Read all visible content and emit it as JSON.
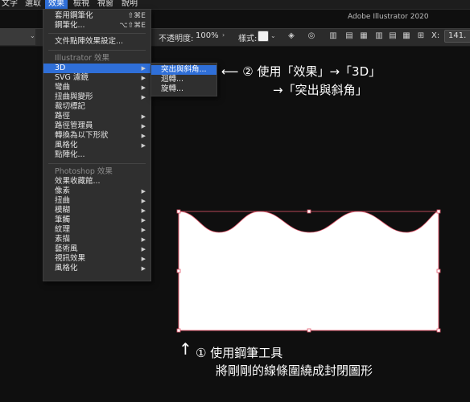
{
  "menubar": {
    "items": [
      {
        "label": "文字",
        "active": false
      },
      {
        "label": "選取",
        "active": false
      },
      {
        "label": "效果",
        "active": true
      },
      {
        "label": "檢視",
        "active": false
      },
      {
        "label": "視窗",
        "active": false
      },
      {
        "label": "說明",
        "active": false
      }
    ]
  },
  "app_title": "Adobe Illustrator 2020",
  "controlbar": {
    "opacity_label": "不透明度:",
    "opacity_value": "100%",
    "style_label": "樣式:",
    "x_label": "X:",
    "x_value": "141."
  },
  "effect_menu": {
    "apply_last": {
      "label": "套用鋼筆化",
      "shortcut": "⇧⌘E"
    },
    "last_effect": {
      "label": "鋼筆化...",
      "shortcut": "⌥⇧⌘E"
    },
    "document_raster": "文件點陣效果設定...",
    "illustrator_section": "Illustrator 效果",
    "illustrator_items": [
      {
        "label": "3D",
        "submenu": true,
        "highlighted": true
      },
      {
        "label": "SVG 濾鏡",
        "submenu": true
      },
      {
        "label": "彎曲",
        "submenu": true
      },
      {
        "label": "扭曲與變形",
        "submenu": true
      },
      {
        "label": "裁切標記",
        "submenu": false
      },
      {
        "label": "路徑",
        "submenu": true
      },
      {
        "label": "路徑管理員",
        "submenu": true
      },
      {
        "label": "轉換為以下形狀",
        "submenu": true
      },
      {
        "label": "風格化",
        "submenu": true
      },
      {
        "label": "點陣化...",
        "submenu": false
      }
    ],
    "photoshop_section": "Photoshop 效果",
    "photoshop_items": [
      {
        "label": "效果收藏館...",
        "submenu": false
      },
      {
        "label": "像素",
        "submenu": true
      },
      {
        "label": "扭曲",
        "submenu": true
      },
      {
        "label": "模糊",
        "submenu": true
      },
      {
        "label": "筆觸",
        "submenu": true
      },
      {
        "label": "紋理",
        "submenu": true
      },
      {
        "label": "素描",
        "submenu": true
      },
      {
        "label": "藝術風",
        "submenu": true
      },
      {
        "label": "視訊效果",
        "submenu": true
      },
      {
        "label": "風格化",
        "submenu": true
      }
    ]
  },
  "submenu_3d": {
    "items": [
      {
        "label": "突出與斜角...",
        "highlighted": true
      },
      {
        "label": "迴轉..."
      },
      {
        "label": "旋轉..."
      }
    ]
  },
  "annotations": {
    "step2_line1": "⟵  ② 使用「效果」→「3D」",
    "step2_line2": "→「突出與斜角」",
    "step1_arrow": "↑",
    "step1_line1": "① 使用鋼筆工具",
    "step1_line2": "將剛剛的線條圍繞成封閉圖形"
  },
  "colors": {
    "accent": "#2f6fd8",
    "selection": "#e0566a",
    "artwork_fill": "#ffffff"
  }
}
